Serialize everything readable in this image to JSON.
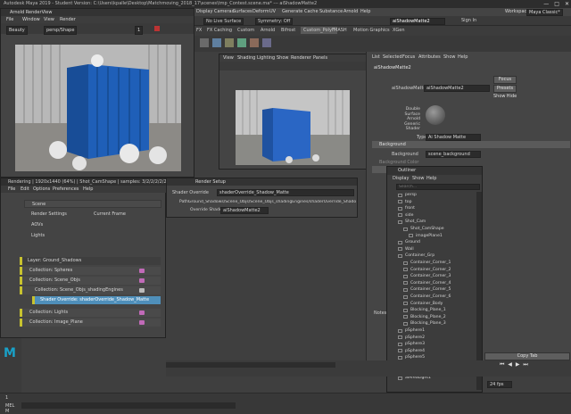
{
  "window": {
    "title": "Autodesk Maya 2019 - Student Version: C:\\Users\\kpalle\\Desktop\\Matchmoving_2018_17\\scenes\\tmp_Contest.scene.ma*  ---  aiShadowMatte2",
    "controls": [
      "—",
      "□",
      "✕"
    ]
  },
  "main_menu": {
    "items": [
      "Display",
      "Cameras",
      "Surfaces",
      "Deform",
      "UV",
      "Generate",
      "Cache",
      "Substance",
      "Arnold",
      "Help"
    ],
    "workspace_label": "Workspace:",
    "workspace_value": "Maya Classic*"
  },
  "status_line": {
    "surface_field": "No Live Surface",
    "symmetry_field": "Symmetry: Off",
    "node_field": "aiShadowMatte2",
    "sign_in": "Sign In"
  },
  "shelf_tabs": [
    "FX",
    "FX Caching",
    "Custom",
    "Arnold",
    "Bifrost",
    "Custom_PolyF",
    "MASH",
    "Motion Graphics",
    "XGen"
  ],
  "render_view": {
    "title": "Arnold RenderView",
    "menu": [
      "File",
      "Window",
      "View",
      "Render"
    ],
    "camera_select": "Beauty",
    "camera_name": "persp/Shape",
    "zoom_value": "1",
    "info_line": "Rendering | 1920x1440 (64%) | Shot_CamShape | samples: 3/2/2/2/2/2/3"
  },
  "viewport": {
    "menu": [
      "View",
      "Shading",
      "Lighting",
      "Show",
      "Renderer",
      "Panels"
    ]
  },
  "render_setup": {
    "menu": [
      "File",
      "Edit",
      "Options",
      "Preferences",
      "Help"
    ],
    "scene_label": "Scene",
    "render_settings_label": "Render Settings",
    "current_frame_label": "Current Frame",
    "aovs_label": "AOVs",
    "lights_label": "Lights",
    "tree": [
      {
        "label": "Layer: Ground_Shadows"
      },
      {
        "label": "Collection: Spheres"
      },
      {
        "label": "Collection: Scene_Objs"
      },
      {
        "label": "Collection: Scene_Objs_shadingEngines"
      },
      {
        "label": "Shader Override: shaderOverride_Shadow_Matte"
      },
      {
        "label": "Collection: Lights"
      },
      {
        "label": "Collection: Image_Plane"
      }
    ]
  },
  "property_editor": {
    "title": "Render Setup",
    "heading": "Shader Override",
    "heading_value": "shaderOverride_Shadow_Matte",
    "path_label": "Path:",
    "path_value": "Ground_Shadows/Scene_Objs/Scene_Objs_shadingEngines/shaderOverride_Shadow_Matte",
    "override_label": "Override Shader",
    "override_value": "aiShadowMatte2"
  },
  "attribute_editor": {
    "menu": [
      "List",
      "Selected",
      "Focus",
      "Attributes",
      "Show",
      "Help"
    ],
    "tab": "aiShadowMatte2",
    "shader_label": "aiShadowMatte:",
    "shader_value": "aiShadowMatte2",
    "focus_btn": "Focus",
    "presets_btn": "Presets",
    "show_btn": "Show",
    "hide_btn": "Hide",
    "swatch_caption": [
      "Double",
      "Surface",
      "Arnold",
      "Generic Shader"
    ],
    "type_label": "Type",
    "type_value": "Ai Shadow Matte",
    "background_section": "Background",
    "background_label": "Background",
    "background_value": "scene_background",
    "background_color_label": "Background Color",
    "notes_label": "Notes:",
    "copy_tab": "Copy Tab"
  },
  "outliner": {
    "title": "Outliner",
    "menu": [
      "Display",
      "Show",
      "Help"
    ],
    "search_placeholder": "Search...",
    "items": [
      {
        "label": "persp",
        "indent": 1
      },
      {
        "label": "top",
        "indent": 1
      },
      {
        "label": "front",
        "indent": 1
      },
      {
        "label": "side",
        "indent": 1
      },
      {
        "label": "Shot_Cam",
        "indent": 1
      },
      {
        "label": "Shot_CamShape",
        "indent": 2
      },
      {
        "label": "imagePlane1",
        "indent": 3
      },
      {
        "label": "Ground",
        "indent": 1
      },
      {
        "label": "Wall",
        "indent": 1
      },
      {
        "label": "Container_Grp",
        "indent": 1
      },
      {
        "label": "Container_Corner_1",
        "indent": 2
      },
      {
        "label": "Container_Corner_2",
        "indent": 2
      },
      {
        "label": "Container_Corner_3",
        "indent": 2
      },
      {
        "label": "Container_Corner_4",
        "indent": 2
      },
      {
        "label": "Container_Corner_5",
        "indent": 2
      },
      {
        "label": "Container_Corner_6",
        "indent": 2
      },
      {
        "label": "Container_Body",
        "indent": 2
      },
      {
        "label": "Blocking_Plane_1",
        "indent": 2
      },
      {
        "label": "Blocking_Plane_2",
        "indent": 2
      },
      {
        "label": "Blocking_Plane_3",
        "indent": 2
      },
      {
        "label": "pSphere1",
        "indent": 1
      },
      {
        "label": "pSphere2",
        "indent": 1
      },
      {
        "label": "pSphere3",
        "indent": 1
      },
      {
        "label": "pSphere4",
        "indent": 1
      },
      {
        "label": "pSphere5",
        "indent": 1
      },
      {
        "label": "directionalLight1",
        "indent": 1
      },
      {
        "label": "aiSkyDomeLight1",
        "indent": 1
      },
      {
        "label": "aiAreaLight1",
        "indent": 1
      }
    ]
  },
  "timeline": {
    "fps": "24 fps"
  },
  "command_line": {
    "mode": "MEL",
    "mode2": "M",
    "frame": "1"
  },
  "colors": {
    "accent_blue": "#4f8fba",
    "layer_yellow": "#c7c22f",
    "override_pink": "#c16ab8",
    "container_blue": "#1f5fb8"
  }
}
